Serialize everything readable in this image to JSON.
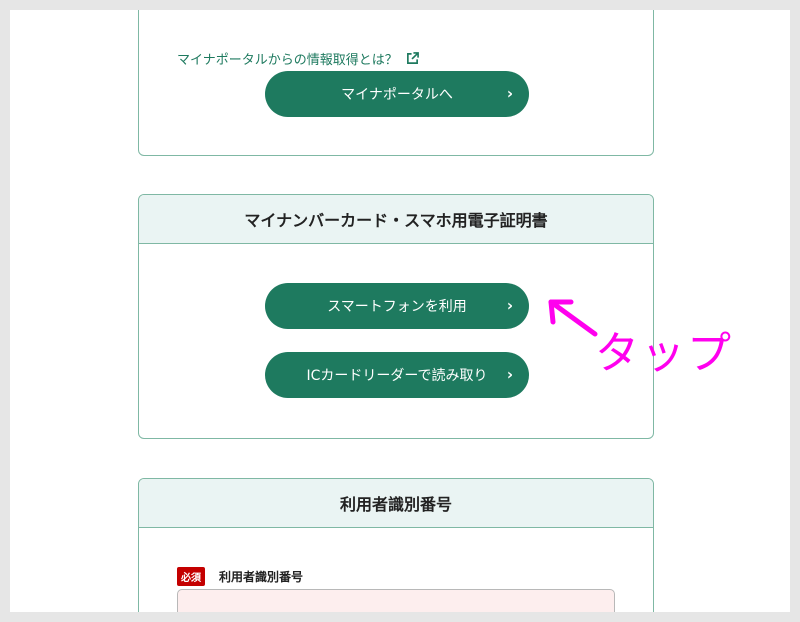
{
  "portal_card": {
    "link_text": "マイナポータルからの情報取得とは？",
    "link_icon": "external-link-icon",
    "button_label": "マイナポータルへ",
    "chevron": "›"
  },
  "cert_card": {
    "title": "マイナンバーカード・スマホ用電子証明書",
    "smartphone_button": "スマートフォンを利用",
    "ic_reader_button": "ICカードリーダーで読み取り",
    "chevron": "›"
  },
  "user_id_card": {
    "title": "利用者識別番号",
    "required_badge": "必須",
    "field_label": "利用者識別番号",
    "input_value": ""
  },
  "annotation": {
    "text": "タップ",
    "color": "#ff00ee"
  },
  "colors": {
    "accent": "#1e7a5f",
    "border": "#7fb8a4",
    "header_bg": "#eaf4f3",
    "required": "#c40000",
    "input_bg": "#fdeeee"
  }
}
